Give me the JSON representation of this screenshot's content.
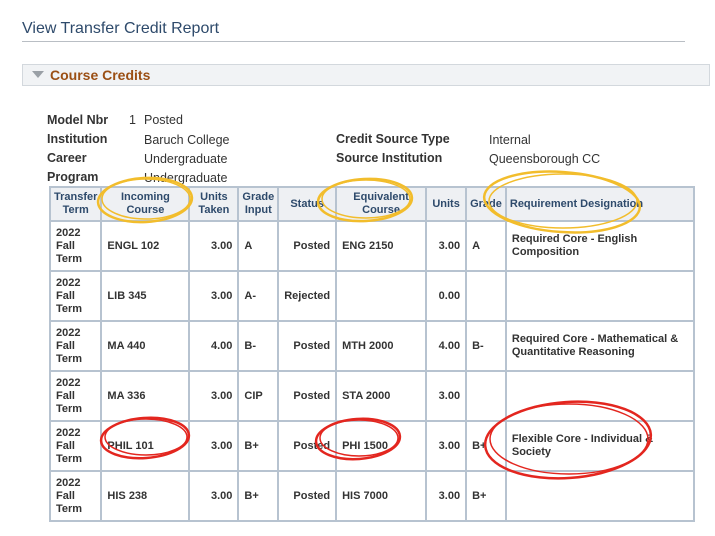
{
  "page": {
    "title": "View Transfer Credit Report"
  },
  "section": {
    "label": "Course Credits"
  },
  "info": {
    "model_nbr_label": "Model Nbr",
    "model_nbr_value": "1",
    "model_status": "Posted",
    "institution_label": "Institution",
    "institution_value": "Baruch College",
    "career_label": "Career",
    "career_value": "Undergraduate",
    "program_label": "Program",
    "program_value": "Undergraduate",
    "credit_source_type_label": "Credit Source Type",
    "credit_source_type_value": "Internal",
    "source_institution_label": "Source Institution",
    "source_institution_value": "Queensborough CC"
  },
  "table": {
    "headers": [
      "Transfer Term",
      "Incoming Course",
      "Units Taken",
      "Grade Input",
      "Status",
      "Equivalent Course",
      "Units",
      "Grade",
      "Requirement Designation"
    ],
    "rows": [
      [
        "2022 Fall Term",
        "ENGL 102",
        "3.00",
        "A",
        "Posted",
        "ENG 2150",
        "3.00",
        "A",
        "Required Core - English Composition"
      ],
      [
        "2022 Fall Term",
        "LIB 345",
        "3.00",
        "A-",
        "Rejected",
        "",
        "0.00",
        "",
        ""
      ],
      [
        "2022 Fall Term",
        "MA 440",
        "4.00",
        "B-",
        "Posted",
        "MTH 2000",
        "4.00",
        "B-",
        "Required Core - Mathematical & Quantitative Reasoning"
      ],
      [
        "2022 Fall Term",
        "MA 336",
        "3.00",
        "CIP",
        "Posted",
        "STA 2000",
        "3.00",
        "",
        ""
      ],
      [
        "2022 Fall Term",
        "PHIL 101",
        "3.00",
        "B+",
        "Posted",
        "PHI 1500",
        "3.00",
        "B+",
        "Flexible Core - Individual & Society"
      ],
      [
        "2022 Fall Term",
        "HIS 238",
        "3.00",
        "B+",
        "Posted",
        "HIS 7000",
        "3.00",
        "B+",
        ""
      ]
    ]
  },
  "annotations": {
    "highlight_yellow": "#f2bd2c",
    "highlight_red": "#e3261f"
  }
}
